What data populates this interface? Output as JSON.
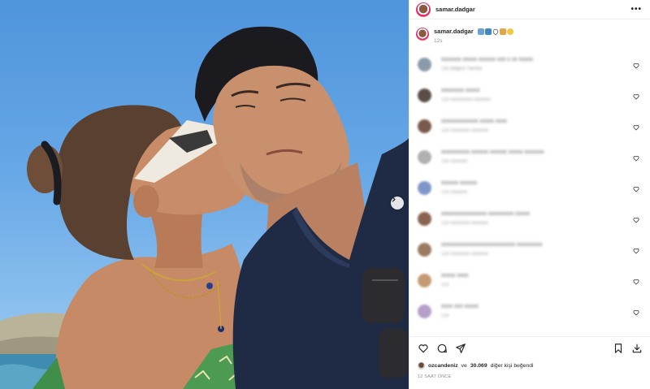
{
  "header": {
    "username": "samar.dadgar",
    "more_label": "•••"
  },
  "caption": {
    "username": "samar.dadgar",
    "time": "12s"
  },
  "comments": [
    {
      "text": "xxxxxxx xxxxx  xxxxxx xxx x xx xxxxx",
      "meta": "13s  Beğeni  Yanıtla",
      "avatar_color": "#8a9aa8"
    },
    {
      "text": "xxxxxxxx xxxxx",
      "meta": "12s  xxxxxxxxx  xxxxxxx",
      "avatar_color": "#5b4e48"
    },
    {
      "text": "xxxxxxxxxxxxx xxxxx  xxxx",
      "meta": "12s  xxxxxxxx  xxxxxxx",
      "avatar_color": "#7a5a4a"
    },
    {
      "text": "xxxxxxxxxx xxxxxx xxxxxx xxxxx xxxxxxx",
      "meta": "13s  xxxxxxx",
      "avatar_color": "#b0b0b0"
    },
    {
      "text": "xxxxxx xxxxxx",
      "meta": "12s  xxxxxxx",
      "avatar_color": "#7f97c7"
    },
    {
      "text": "xxxxxxxxxxxxxxxx xxxxxxxxx xxxxx",
      "meta": "12s  xxxxxxxx  xxxxxxx",
      "avatar_color": "#8a6250"
    },
    {
      "text": "xxxxxxxxxxxxxxxxxxxxxxxxxx xxxxxxxxx",
      "meta": "12s  xxxxxxxx  xxxxxxx",
      "avatar_color": "#9a7a60"
    },
    {
      "text": "xxxxx xxxx",
      "meta": "12s",
      "avatar_color": "#c59a72"
    },
    {
      "text": "xxxx xxx xxxxx",
      "meta": "12s",
      "avatar_color": "#b4a0c8"
    }
  ],
  "likes": {
    "liker": "ozcandeniz",
    "connector": "ve",
    "count": "30.069",
    "suffix": "diğer kişi beğendi"
  },
  "post_time": "12 SAAT ÖNCE",
  "colors": {
    "sky": "#5d9fe0",
    "shirt": "#1f2a44",
    "cap": "#1b1b1f",
    "accent": "#e1306c"
  },
  "icons": [
    "more-icon",
    "heart-icon",
    "comment-icon",
    "share-icon",
    "save-icon",
    "download-icon",
    "chevron-right-icon"
  ]
}
